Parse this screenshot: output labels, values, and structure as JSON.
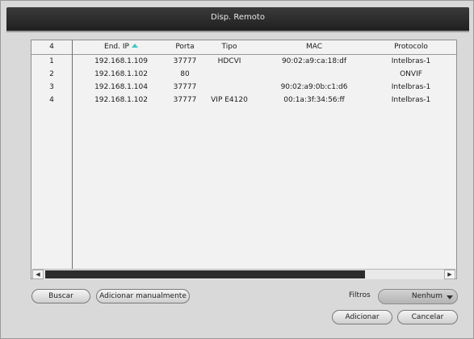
{
  "dialog": {
    "title": "Disp. Remoto"
  },
  "table": {
    "columns": [
      {
        "key": "index",
        "label": "4"
      },
      {
        "key": "ip",
        "label": "End. IP"
      },
      {
        "key": "port",
        "label": "Porta"
      },
      {
        "key": "type",
        "label": "Tipo"
      },
      {
        "key": "mac",
        "label": "MAC"
      },
      {
        "key": "protocol",
        "label": "Protocolo"
      }
    ],
    "rows": [
      {
        "index": "1",
        "ip": "192.168.1.109",
        "port": "37777",
        "type": "HDCVI",
        "mac": "90:02:a9:ca:18:df",
        "protocol": "Intelbras-1"
      },
      {
        "index": "2",
        "ip": "192.168.1.102",
        "port": "80",
        "type": "",
        "mac": "",
        "protocol": "ONVIF"
      },
      {
        "index": "3",
        "ip": "192.168.1.104",
        "port": "37777",
        "type": "",
        "mac": "90:02:a9:0b:c1:d6",
        "protocol": "Intelbras-1"
      },
      {
        "index": "4",
        "ip": "192.168.1.102",
        "port": "37777",
        "type": "VIP E4120",
        "mac": "00:1a:3f:34:56:ff",
        "protocol": "Intelbras-1"
      }
    ],
    "scroll_left_icon": "arrow-left-icon",
    "scroll_right_icon": "arrow-right-icon"
  },
  "buttons": {
    "search": "Buscar",
    "add_manual": "Adicionar manualmente",
    "add": "Adicionar",
    "cancel": "Cancelar"
  },
  "filter": {
    "label": "Filtros",
    "value": "Nenhum"
  },
  "colors": {
    "title_bar": "#2b2b2b",
    "sort_indicator": "#3fc6c6",
    "background": "#d9d9d9"
  }
}
